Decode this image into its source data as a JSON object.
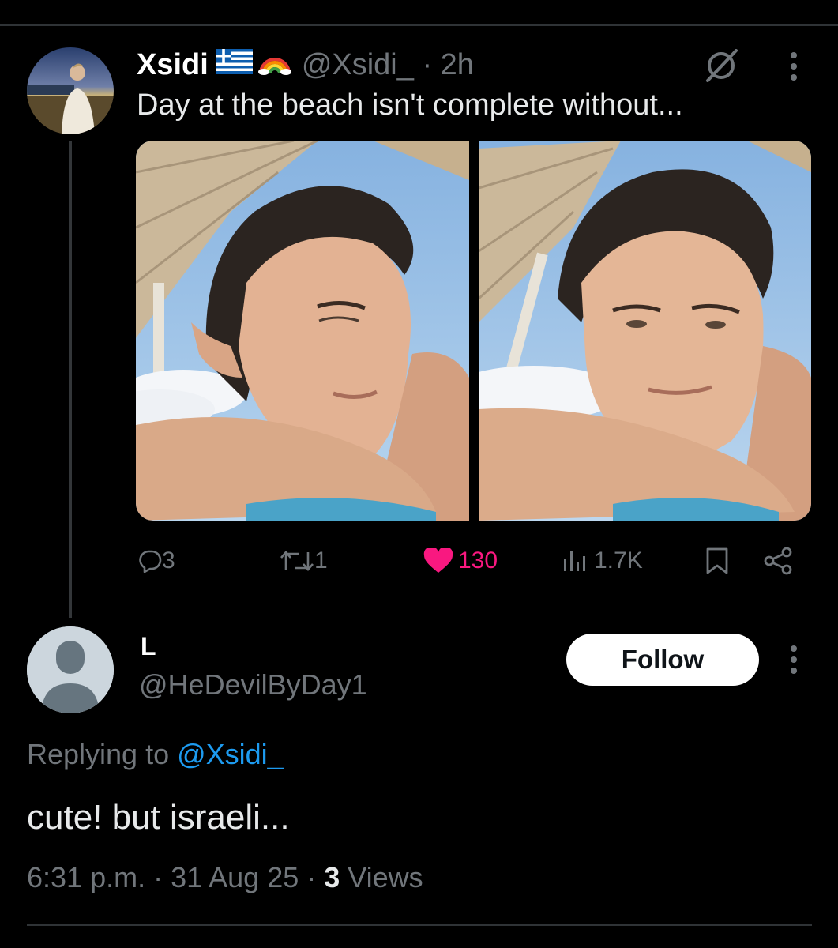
{
  "tweet": {
    "author_name": "Xsidi",
    "badges": [
      "🇬🇷",
      "🏳️‍🌈"
    ],
    "handle": "@Xsidi_",
    "time_sep": " · ",
    "time": "2h",
    "text": "Day at the beach isn't complete without...",
    "images": [
      "beach-selfie-looking-right",
      "beach-selfie-facing-camera"
    ],
    "icons": {
      "grok": "grok-icon",
      "more": "more-vertical-icon"
    },
    "actions": {
      "replies": "3",
      "reposts": "1",
      "likes": "130",
      "views": "1.7K"
    },
    "accent_colors": {
      "like": "#f91880",
      "link": "#1d9bf0"
    }
  },
  "reply": {
    "author_name": "L",
    "handle": "@HeDevilByDay1",
    "follow_label": "Follow",
    "replying_prefix": "Replying to ",
    "replying_to": "@Xsidi_",
    "text": "cute! but israeli...",
    "timestamp": "6:31 p.m. · 31 Aug 25 · ",
    "views_count": "3",
    "views_label": " Views"
  }
}
